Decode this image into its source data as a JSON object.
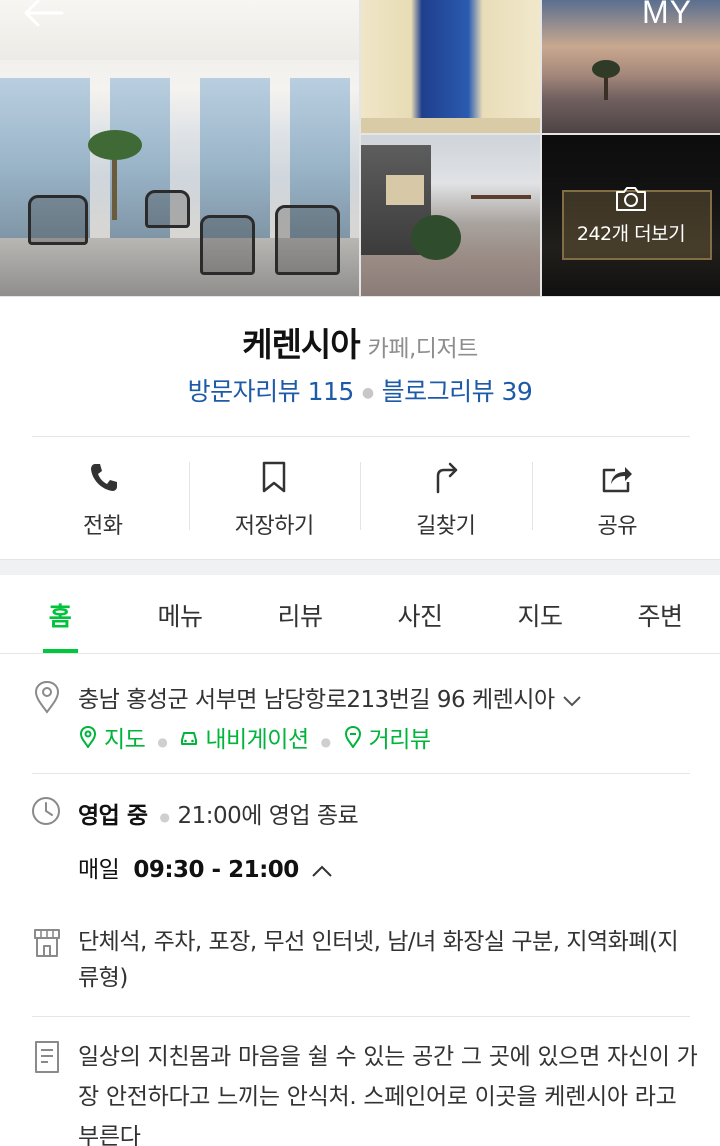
{
  "header": {
    "my_label": "MY",
    "icons": {
      "back": "arrow-left-icon"
    }
  },
  "gallery": {
    "more_label": "242개 더보기",
    "more_icon": "camera-icon"
  },
  "place": {
    "name": "케렌시아",
    "category": "카페,디저트",
    "visitor_reviews": "방문자리뷰 115",
    "blog_reviews": "블로그리뷰 39"
  },
  "actions": [
    {
      "label": "전화",
      "icon": "phone-icon"
    },
    {
      "label": "저장하기",
      "icon": "bookmark-icon"
    },
    {
      "label": "길찾기",
      "icon": "directions-icon"
    },
    {
      "label": "공유",
      "icon": "share-icon"
    }
  ],
  "tabs": [
    {
      "label": "홈"
    },
    {
      "label": "메뉴"
    },
    {
      "label": "리뷰"
    },
    {
      "label": "사진"
    },
    {
      "label": "지도"
    },
    {
      "label": "주변"
    }
  ],
  "address": {
    "text": "충남 홍성군 서부면 남당항로213번길 96 케렌시아",
    "links": [
      {
        "label": "지도",
        "icon": "map-pin-icon"
      },
      {
        "label": "내비게이션",
        "icon": "car-icon"
      },
      {
        "label": "거리뷰",
        "icon": "street-view-icon"
      }
    ]
  },
  "hours": {
    "status": "영업 중",
    "note": "21:00에 영업 종료",
    "day": "매일",
    "time": "09:30 - 21:00"
  },
  "amenities": "단체석, 주차, 포장, 무선 인터넷, 남/녀 화장실 구분, 지역화폐(지류형)",
  "description": "일상의 지친몸과 마음을 쉴 수 있는 공간 그 곳에 있으면 자신이 가장 안전하다고 느끼는 안식처. 스페인어로 이곳을 케렌시아 라고 부른다",
  "colors": {
    "accent_green": "#00c73c",
    "review_blue": "#1d5aa8"
  }
}
